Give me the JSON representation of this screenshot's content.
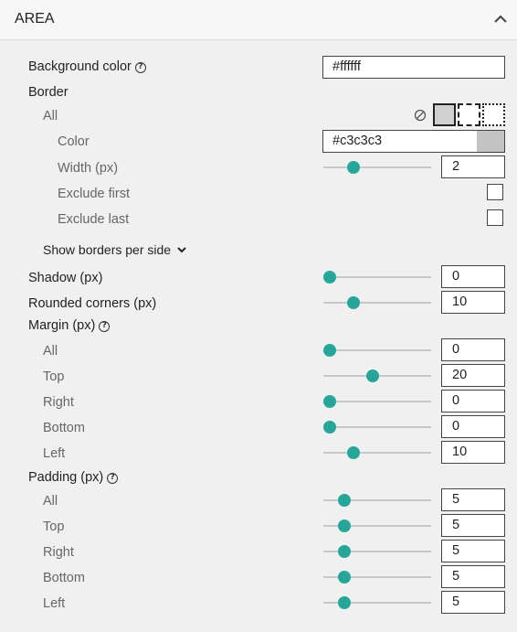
{
  "header": {
    "title": "AREA"
  },
  "background": {
    "label": "Background color",
    "value": "#ffffff",
    "swatch": "#ffffff"
  },
  "border": {
    "label": "Border",
    "all_label": "All",
    "color_label": "Color",
    "color_value": "#c3c3c3",
    "color_swatch": "#c3c3c3",
    "width_label": "Width (px)",
    "width_value": "2",
    "width_fraction": 0.25,
    "exclude_first_label": "Exclude first",
    "exclude_first_checked": false,
    "exclude_last_label": "Exclude last",
    "exclude_last_checked": false,
    "show_per_side_label": "Show borders per side"
  },
  "shadow": {
    "label": "Shadow (px)",
    "value": "0",
    "fraction": 0.0
  },
  "rounded": {
    "label": "Rounded corners (px)",
    "value": "10",
    "fraction": 0.25
  },
  "margin": {
    "label": "Margin (px)",
    "rows": [
      {
        "label": "All",
        "value": "0",
        "fraction": 0.0
      },
      {
        "label": "Top",
        "value": "20",
        "fraction": 0.45
      },
      {
        "label": "Right",
        "value": "0",
        "fraction": 0.0
      },
      {
        "label": "Bottom",
        "value": "0",
        "fraction": 0.0
      },
      {
        "label": "Left",
        "value": "10",
        "fraction": 0.25
      }
    ]
  },
  "padding": {
    "label": "Padding (px)",
    "rows": [
      {
        "label": "All",
        "value": "5",
        "fraction": 0.15
      },
      {
        "label": "Top",
        "value": "5",
        "fraction": 0.15
      },
      {
        "label": "Right",
        "value": "5",
        "fraction": 0.15
      },
      {
        "label": "Bottom",
        "value": "5",
        "fraction": 0.15
      },
      {
        "label": "Left",
        "value": "5",
        "fraction": 0.15
      }
    ]
  },
  "colors": {
    "accent": "#26a69a",
    "track": "#c8c8c8"
  }
}
